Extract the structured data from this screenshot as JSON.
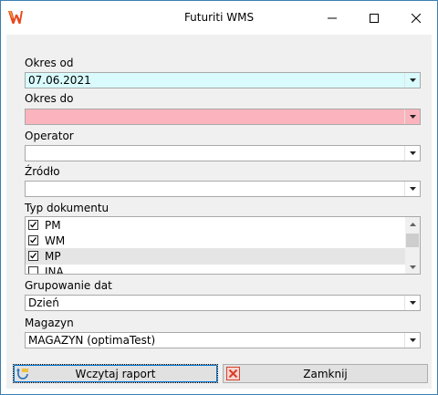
{
  "window": {
    "title": "Futuriti WMS",
    "icon": "futuriti-logo-icon",
    "accent_color": "#e8481c"
  },
  "form": {
    "date_from": {
      "label": "Okres od",
      "value": "07.06.2021",
      "bg_color": "#d9fbfd"
    },
    "date_to": {
      "label": "Okres do",
      "value": "",
      "bg_color": "#fbb4bd"
    },
    "operator": {
      "label": "Operator",
      "value": ""
    },
    "source": {
      "label": "Źródło",
      "value": ""
    },
    "doc_type": {
      "label": "Typ dokumentu",
      "items": [
        {
          "label": "PM",
          "checked": true
        },
        {
          "label": "WM",
          "checked": true
        },
        {
          "label": "MP",
          "checked": true,
          "selected": true
        },
        {
          "label": "INA",
          "checked": false
        }
      ]
    },
    "date_grouping": {
      "label": "Grupowanie dat",
      "value": "Dzień"
    },
    "warehouse": {
      "label": "Magazyn",
      "value": "MAGAZYN (optimaTest)"
    }
  },
  "buttons": {
    "load_report": "Wczytaj raport",
    "close": "Zamknij"
  }
}
